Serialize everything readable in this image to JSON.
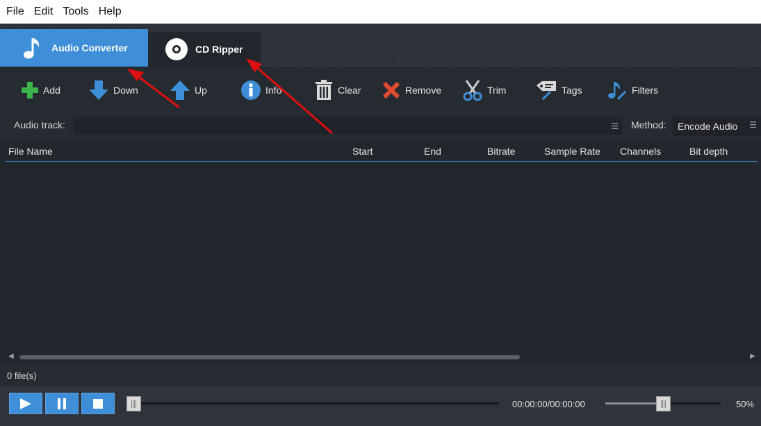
{
  "menu": [
    "File",
    "Edit",
    "Tools",
    "Help"
  ],
  "tabs": {
    "audio_converter": "Audio Converter",
    "cd_ripper": "CD Ripper"
  },
  "toolbar": {
    "add": "Add",
    "down": "Down",
    "up": "Up",
    "info": "Info",
    "clear": "Clear",
    "remove": "Remove",
    "trim": "Trim",
    "tags": "Tags",
    "filters": "Filters"
  },
  "track": {
    "label": "Audio track:",
    "value": "",
    "method_label": "Method:",
    "method_value": "Encode Audio"
  },
  "table": {
    "columns": [
      "File Name",
      "Start",
      "End",
      "Bitrate",
      "Sample Rate",
      "Channels",
      "Bit depth"
    ],
    "rows": []
  },
  "status": {
    "file_count": "0 file(s)"
  },
  "player": {
    "time": "00:00:00/00:00:00",
    "seek_fraction": 0,
    "volume_label": "50%",
    "volume_fraction": 0.5
  },
  "colors": {
    "accent": "#3f8fd8",
    "annotation_arrow": "#e01010",
    "add_icon": "#3bb54a",
    "remove_icon": "#e04a2f"
  },
  "icons": {
    "audio_tab": "music-note-icon",
    "cd_tab": "disc-icon",
    "add": "plus-icon",
    "down": "arrow-down-icon",
    "up": "arrow-up-icon",
    "info": "info-icon",
    "clear": "trash-icon",
    "remove": "x-icon",
    "trim": "scissors-icon",
    "tags": "tag-icon",
    "filters": "music-filter-icon"
  }
}
